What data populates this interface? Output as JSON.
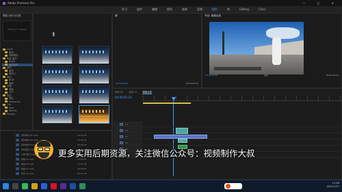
{
  "app": {
    "title": "Adobe Premiere Pro"
  },
  "menu": {
    "items": [
      "学习",
      "组件",
      "编辑",
      "颜色",
      "效果",
      "音频",
      "图形",
      "库",
      "Editing",
      "Color"
    ],
    "active_index": 6
  },
  "project_panel": {
    "tabs": [
      "项目",
      "媒体浏览器"
    ],
    "search_placeholder": "",
    "folders": [
      "Local",
      "素材",
      "视频素材",
      "夜景 城市",
      "Night",
      "城市延时",
      "延时",
      "素材",
      "素材 2",
      "音乐",
      "BGM",
      "音效",
      "字幕",
      "调色",
      "LUT",
      "导出",
      "项目",
      "Sequence",
      "Old",
      "New",
      "Render",
      "Presets"
    ],
    "active_folder_index": 5,
    "left_note": "Nothing to display"
  },
  "media_grid": {
    "thumbnails": [
      "",
      "",
      "",
      "",
      "",
      "",
      "",
      "",
      "",
      ""
    ],
    "selected_index": 9
  },
  "source_panel": {
    "title": "源",
    "timecode_left": "00:00:00:00",
    "timecode_right": "00:00:05:00"
  },
  "program_panel": {
    "title": "节目: 视频合成",
    "timecode_left": "00:00:00:00",
    "timecode_right": "00:00:06:00",
    "fit_label": "适合"
  },
  "timeline": {
    "tabs": [
      "序列 01",
      "合成 01",
      "视频合成"
    ],
    "active_tab": 2,
    "timecode": "00:00:02:19",
    "tracks": [
      "V3",
      "V2",
      "V1",
      "A1",
      "A2",
      "A3"
    ]
  },
  "file_list": {
    "rows": [
      {
        "name": "延时素材 01.mp4",
        "info": "00:00:05"
      },
      {
        "name": "延时素材 02.mp4",
        "info": "00:00:05"
      },
      {
        "name": "延时素材 03.mp4",
        "info": "00:00:05"
      },
      {
        "name": "城市夜景.mp4",
        "info": "00:00:05"
      },
      {
        "name": "人物 骑行.mp4",
        "info": "00:00:06"
      },
      {
        "name": "航拍 01.mp4",
        "info": "00:00:04"
      },
      {
        "name": "航拍 02.mp4",
        "info": "00:00:04"
      },
      {
        "name": "航拍 03.mp4",
        "info": "00:00:04"
      },
      {
        "name": "音乐 01.mp3",
        "info": "00:01:20"
      }
    ]
  },
  "overlay": {
    "subtitle": "更多实用后期资源，关注微信公众号：视频制作大叔"
  },
  "taskbar": {
    "time": "11:26",
    "date": "2021/7/27"
  },
  "colors": {
    "accent": "#3d9cff",
    "clip_video": "#4da7a0",
    "clip_audio": "#3a8f4a"
  }
}
